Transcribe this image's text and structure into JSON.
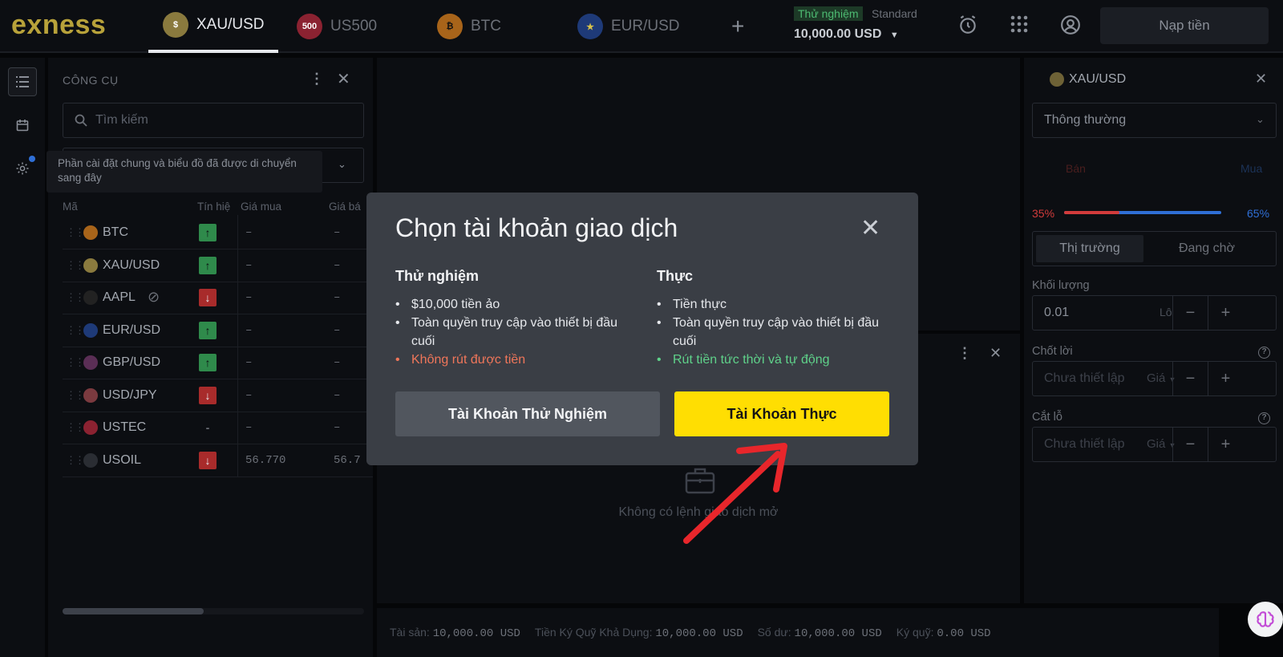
{
  "topbar": {
    "logo": "exness",
    "tabs": [
      {
        "label": "XAU/USD",
        "active": true
      },
      {
        "label": "US500",
        "active": false
      },
      {
        "label": "BTC",
        "active": false
      },
      {
        "label": "EUR/USD",
        "active": false
      }
    ],
    "add_tab": "+",
    "account_mode": "Thử nghiệm",
    "account_type": "Standard",
    "balance": "10,000.00 USD",
    "deposit_label": "Nạp tiền"
  },
  "instruments": {
    "title": "CÔNG CỤ",
    "search_placeholder": "Tìm kiếm",
    "tooltip": "Phần cài đặt chung và biểu đồ đã được di chuyển sang đây",
    "columns": [
      "Mã",
      "Tín hiệ",
      "Giá mua",
      "Giá bá"
    ],
    "rows": [
      {
        "symbol": "BTC",
        "signal": "up",
        "signal_glyph": "↑",
        "bid": "–",
        "ask": "–"
      },
      {
        "symbol": "XAU/USD",
        "signal": "up",
        "signal_glyph": "↑",
        "bid": "–",
        "ask": "–"
      },
      {
        "symbol": "AAPL",
        "signal": "down",
        "signal_glyph": "↓",
        "bid": "–",
        "ask": "–"
      },
      {
        "symbol": "EUR/USD",
        "signal": "up",
        "signal_glyph": "↑",
        "bid": "–",
        "ask": "–"
      },
      {
        "symbol": "GBP/USD",
        "signal": "up",
        "signal_glyph": "↑",
        "bid": "–",
        "ask": "–"
      },
      {
        "symbol": "USD/JPY",
        "signal": "down",
        "signal_glyph": "↓",
        "bid": "–",
        "ask": "–"
      },
      {
        "symbol": "USTEC",
        "signal": "none",
        "signal_glyph": "-",
        "bid": "–",
        "ask": "–"
      },
      {
        "symbol": "USOIL",
        "signal": "down",
        "signal_glyph": "↓",
        "bid": "56.770",
        "ask": "56.7"
      }
    ]
  },
  "positions": {
    "empty_text": "Không có lệnh giao dịch mở"
  },
  "bottombar": {
    "assets_label": "Tài sản:",
    "assets_value": "10,000.00 USD",
    "free_margin_label": "Tiền Ký Quỹ Khả Dụng:",
    "free_margin_value": "10,000.00 USD",
    "balance_label": "Số dư:",
    "balance_value": "10,000.00 USD",
    "margin_label": "Ký quỹ:",
    "margin_value": "0.00 USD"
  },
  "order": {
    "symbol": "XAU/USD",
    "mode": "Thông thường",
    "sell_label": "Bán",
    "buy_label": "Mua",
    "sell_pct": "35%",
    "buy_pct": "65%",
    "sentiment_sell_fraction": 0.35,
    "tab_market": "Thị trường",
    "tab_pending": "Đang chờ",
    "volume_label": "Khối lượng",
    "volume_value": "0.01",
    "volume_unit": "Lô",
    "tp_label": "Chốt lời",
    "sl_label": "Cắt lỗ",
    "not_set": "Chưa thiết lập",
    "price_select": "Giá",
    "minus": "−",
    "plus": "+"
  },
  "modal": {
    "title": "Chọn tài khoản giao dịch",
    "demo": {
      "heading": "Thử nghiệm",
      "items": [
        "$10,000 tiền ảo",
        "Toàn quyền truy cập vào thiết bị đầu cuối"
      ],
      "con": "Không rút được tiền",
      "button": "Tài Khoản Thử Nghiệm"
    },
    "real": {
      "heading": "Thực",
      "items": [
        "Tiền thực",
        "Toàn quyền truy cập vào thiết bị đầu cuối"
      ],
      "pro": "Rút tiền tức thời và tự động",
      "button": "Tài Khoản Thực"
    }
  },
  "colors": {
    "accent_yellow": "#ffde02",
    "sell_red": "#d23b3b",
    "buy_blue": "#2f6fd6",
    "signal_up": "#2f8a4b",
    "signal_down": "#a82b2b",
    "annotation_arrow": "#e8262b"
  }
}
